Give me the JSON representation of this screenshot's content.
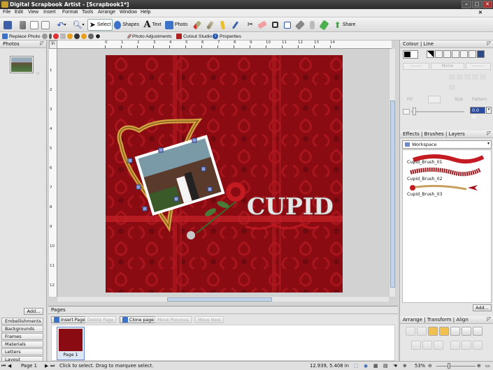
{
  "window": {
    "title": "Digital Scrapbook Artist - [Scrapbook1*]"
  },
  "menu": [
    "File",
    "Edit",
    "View",
    "Insert",
    "Format",
    "Tools",
    "Arrange",
    "Window",
    "Help"
  ],
  "toolbar": {
    "select_label": "Select",
    "shapes_label": "Shapes",
    "text_label": "Text",
    "photo_label": "Photo",
    "share_label": "Share"
  },
  "toolbar2": {
    "replace_photo": "Replace Photo",
    "photo_adjustments": "Photo Adjustments",
    "cutout_studio": "Cutout Studio",
    "properties": "Properties"
  },
  "left_panel": {
    "photos_title": "Photos",
    "add_button": "Add...",
    "categories": [
      "Embellishments",
      "Backgrounds",
      "Frames",
      "Materials",
      "Letters",
      "Layout"
    ]
  },
  "ruler": {
    "h_ticks": [
      "0",
      "1",
      "2",
      "3",
      "4",
      "5",
      "6",
      "7",
      "8",
      "9",
      "10",
      "11",
      "12",
      "13",
      "14"
    ],
    "v_ticks": [
      "1",
      "2",
      "3",
      "4",
      "5",
      "6",
      "7",
      "8",
      "9",
      "10",
      "11",
      "12"
    ]
  },
  "canvas": {
    "title_text": "CUPID"
  },
  "colour_panel": {
    "tab": "Colour | Line",
    "none_label": "None",
    "width_value": "0.0 pt",
    "fill_label": "Fill",
    "pattern_label": "Pattern",
    "size_label": "Size",
    "none2_label": "None"
  },
  "effects_panel": {
    "tabs": "Effects | Brushes | Layers",
    "workspace": "Workspace",
    "brushes": [
      "Cupid_Brush_01",
      "Cupid_Brush_02",
      "Cupid_Brush_03"
    ],
    "add_button": "Add..."
  },
  "arrange_panel": {
    "tabs": "Arrange | Transform | Align"
  },
  "pages": {
    "title": "Pages",
    "insert_page": "Insert Page",
    "delete_page": "Delete Page",
    "clone_page": "Clone page",
    "move_previous": "Move Previous",
    "move_next": "Move Next",
    "page1_label": "Page 1"
  },
  "status": {
    "page": "Page 1",
    "hint": "Click to select. Drag to marquee select.",
    "coords": "12.939, 5.408 in",
    "zoom": "53%"
  },
  "colors": {
    "bg_red": "#8a0c12",
    "accent_red": "#c41a22",
    "gold": "#d4a040"
  }
}
